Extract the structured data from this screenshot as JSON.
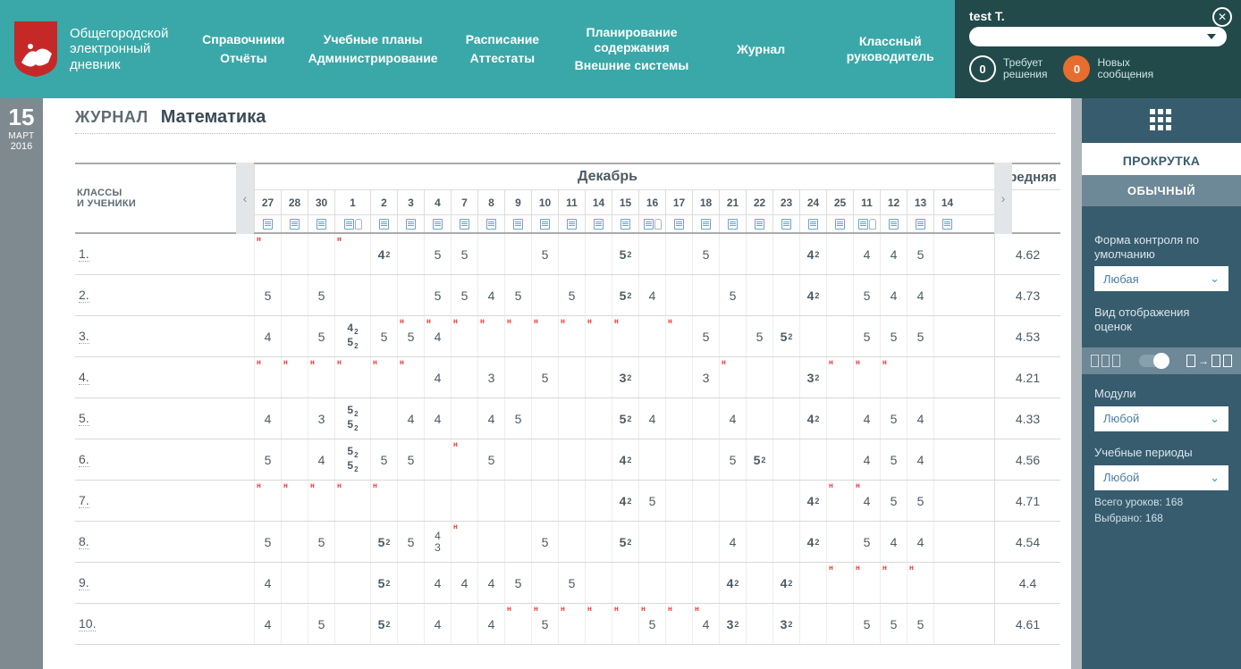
{
  "header": {
    "title_l1": "Общегородской",
    "title_l2": "электронный",
    "title_l3": "дневник",
    "nav": [
      [
        "Справочники",
        "Отчёты"
      ],
      [
        "Учебные планы",
        "Администрирование"
      ],
      [
        "Расписание",
        "Аттестаты"
      ],
      [
        "Планирование содержания",
        "Внешние системы"
      ],
      [
        "Журнал",
        ""
      ],
      [
        "Классный руководитель",
        ""
      ]
    ]
  },
  "user": {
    "name": "test T.",
    "counter1": {
      "n": "0",
      "label_l1": "Требует",
      "label_l2": "решения"
    },
    "counter2": {
      "n": "0",
      "label_l1": "Новых",
      "label_l2": "сообщения"
    }
  },
  "date": {
    "day": "15",
    "month": "МАРТ",
    "year": "2016"
  },
  "title": {
    "section": "ЖУРНАЛ",
    "subject": "Математика"
  },
  "grid": {
    "students_head_l1": "КЛАССЫ",
    "students_head_l2": "И УЧЕНИКИ",
    "month_main": "Декабрь",
    "avg_head": "Средняя",
    "days": [
      "27",
      "28",
      "30",
      "1",
      "2",
      "3",
      "4",
      "7",
      "8",
      "9",
      "10",
      "11",
      "14",
      "15",
      "16",
      "17",
      "18",
      "21",
      "22",
      "23",
      "24",
      "25",
      "11",
      "12",
      "13",
      "14"
    ],
    "wide_idx": [
      3
    ],
    "icons": [
      "b",
      "b",
      "b",
      "bc",
      "b",
      "b",
      "b",
      "b",
      "b",
      "b",
      "b",
      "b",
      "b",
      "b",
      "bc",
      "b",
      "b",
      "b",
      "b",
      "b",
      "b",
      "b",
      "bc",
      "b",
      "b",
      "b"
    ],
    "students": [
      "1.",
      "2.",
      "3.",
      "4.",
      "5.",
      "6.",
      "7.",
      "8.",
      "9.",
      "10."
    ],
    "grades": [
      [
        {
          "h": 1
        },
        {},
        {},
        {
          "h": 1
        },
        {
          "v": "4",
          "s": "2",
          "b": 1
        },
        {},
        {
          "v": "5"
        },
        {
          "v": "5"
        },
        {},
        {},
        {
          "v": "5"
        },
        {},
        {},
        {
          "v": "5",
          "s": "2",
          "b": 1
        },
        {},
        {},
        {
          "v": "5"
        },
        {},
        {},
        {},
        {
          "v": "4",
          "s": "2",
          "b": 1
        },
        {},
        {
          "v": "4"
        },
        {
          "v": "4"
        },
        {
          "v": "5"
        },
        {}
      ],
      [
        {
          "v": "5"
        },
        {},
        {
          "v": "5"
        },
        {},
        {},
        {},
        {
          "v": "5"
        },
        {
          "v": "5"
        },
        {
          "v": "4"
        },
        {
          "v": "5"
        },
        {},
        {
          "v": "5"
        },
        {},
        {
          "v": "5",
          "s": "2",
          "b": 1
        },
        {
          "v": "4"
        },
        {},
        {},
        {
          "v": "5"
        },
        {},
        {},
        {
          "v": "4",
          "s": "2",
          "b": 1
        },
        {},
        {
          "v": "5"
        },
        {
          "v": "4"
        },
        {
          "v": "4"
        },
        {}
      ],
      [
        {
          "v": "4"
        },
        {},
        {
          "v": "5"
        },
        {
          "st": [
            "4_2",
            "5_2"
          ]
        },
        {
          "v": "5"
        },
        {
          "v": "5",
          "h": 1
        },
        {
          "h": 1,
          "v": "4"
        },
        {
          "h": 1
        },
        {
          "h": 1
        },
        {
          "h": 1
        },
        {
          "h": 1
        },
        {
          "h": 1
        },
        {
          "h": 1
        },
        {
          "h": 1
        },
        {},
        {
          "h": 1
        },
        {
          "v": "5"
        },
        {},
        {
          "v": "5"
        },
        {
          "v": "5",
          "s": "2",
          "b": 1
        },
        {},
        {},
        {
          "v": "5"
        },
        {
          "v": "5"
        },
        {
          "v": "5"
        },
        {}
      ],
      [
        {
          "h": 1
        },
        {
          "h": 1
        },
        {
          "h": 1
        },
        {
          "h": 1
        },
        {
          "h": 1
        },
        {
          "h": 1
        },
        {
          "v": "4"
        },
        {},
        {
          "v": "3"
        },
        {},
        {
          "v": "5"
        },
        {},
        {},
        {
          "v": "3",
          "s": "2",
          "b": 1
        },
        {},
        {},
        {
          "v": "3"
        },
        {
          "h": 1
        },
        {},
        {},
        {
          "v": "3",
          "s": "2",
          "b": 1
        },
        {
          "h": 1
        },
        {
          "h": 1
        },
        {
          "h": 1
        },
        {},
        {}
      ],
      [
        {
          "v": "4"
        },
        {},
        {
          "v": "3"
        },
        {
          "st": [
            "5_2",
            "5_2"
          ]
        },
        {},
        {
          "v": "4"
        },
        {
          "v": "4"
        },
        {},
        {
          "v": "4"
        },
        {
          "v": "5"
        },
        {},
        {},
        {},
        {
          "v": "5",
          "s": "2",
          "b": 1
        },
        {
          "v": "4"
        },
        {},
        {},
        {
          "v": "4"
        },
        {},
        {},
        {
          "v": "4",
          "s": "2",
          "b": 1
        },
        {},
        {
          "v": "4"
        },
        {
          "v": "5"
        },
        {
          "v": "4"
        },
        {}
      ],
      [
        {
          "v": "5"
        },
        {},
        {
          "v": "4"
        },
        {
          "st": [
            "5_2",
            "5_2"
          ]
        },
        {
          "v": "5"
        },
        {
          "v": "5"
        },
        {},
        {
          "h": 1
        },
        {
          "v": "5"
        },
        {},
        {},
        {},
        {},
        {
          "v": "4",
          "s": "2",
          "b": 1
        },
        {},
        {},
        {},
        {
          "v": "5"
        },
        {
          "v": "5",
          "s": "2",
          "b": 1
        },
        {},
        {},
        {},
        {
          "v": "4"
        },
        {
          "v": "5"
        },
        {
          "v": "4"
        },
        {}
      ],
      [
        {
          "h": 1
        },
        {
          "h": 1
        },
        {
          "h": 1
        },
        {
          "h": 1
        },
        {
          "h": 1
        },
        {},
        {},
        {},
        {},
        {},
        {},
        {},
        {},
        {
          "v": "4",
          "s": "2",
          "b": 1
        },
        {
          "v": "5"
        },
        {},
        {},
        {},
        {},
        {},
        {
          "v": "4",
          "s": "2",
          "b": 1
        },
        {
          "h": 1
        },
        {
          "v": "4",
          "h": 1
        },
        {
          "v": "5"
        },
        {
          "v": "5"
        },
        {}
      ],
      [
        {
          "v": "5"
        },
        {},
        {
          "v": "5"
        },
        {},
        {
          "v": "5",
          "s": "2",
          "b": 1
        },
        {
          "v": "5"
        },
        {
          "v": "4",
          "sp": "3"
        },
        {
          "h": 1
        },
        {},
        {},
        {
          "v": "5"
        },
        {},
        {},
        {
          "v": "5",
          "s": "2",
          "b": 1
        },
        {},
        {},
        {},
        {
          "v": "4"
        },
        {},
        {},
        {
          "v": "4",
          "s": "2",
          "b": 1
        },
        {},
        {
          "v": "5"
        },
        {
          "v": "4"
        },
        {
          "v": "4"
        },
        {}
      ],
      [
        {
          "v": "4"
        },
        {},
        {},
        {},
        {
          "v": "5",
          "s": "2",
          "b": 1
        },
        {},
        {
          "v": "4"
        },
        {
          "v": "4"
        },
        {
          "v": "4"
        },
        {
          "v": "5"
        },
        {},
        {
          "v": "5"
        },
        {},
        {},
        {},
        {},
        {},
        {
          "v": "4",
          "s": "2",
          "b": 1
        },
        {},
        {
          "v": "4",
          "s": "2",
          "b": 1
        },
        {},
        {
          "h": 1
        },
        {
          "h": 1
        },
        {
          "h": 1
        },
        {
          "h": 1
        },
        {}
      ],
      [
        {
          "v": "4"
        },
        {},
        {
          "v": "5"
        },
        {},
        {
          "v": "5",
          "s": "2",
          "b": 1
        },
        {},
        {
          "v": "4"
        },
        {},
        {
          "v": "4"
        },
        {
          "h": 1
        },
        {
          "h": 1,
          "v": "5"
        },
        {
          "h": 1
        },
        {
          "h": 1
        },
        {
          "h": 1
        },
        {
          "h": 1,
          "v": "5"
        },
        {
          "h": 1
        },
        {
          "h": 1,
          "v": "4"
        },
        {
          "v": "3",
          "s": "2",
          "b": 1
        },
        {},
        {
          "v": "3",
          "s": "2",
          "b": 1
        },
        {},
        {},
        {
          "v": "5"
        },
        {
          "v": "5"
        },
        {
          "v": "5"
        },
        {}
      ]
    ],
    "avgs": [
      "4.62",
      "4.73",
      "4.53",
      "4.21",
      "4.33",
      "4.56",
      "4.71",
      "4.54",
      "4.4",
      "4.61"
    ]
  },
  "side": {
    "scroll_title": "ПРОКРУТКА",
    "mode": "ОБЫЧНЫЙ",
    "control_label": "Форма контроля по умолчанию",
    "control_value": "Любая",
    "view_label": "Вид отображения оценок",
    "modules_label": "Модули",
    "modules_value": "Любой",
    "periods_label": "Учебные периоды",
    "periods_value": "Любой",
    "total_lessons": "Всего уроков: 168",
    "selected": "Выбрано: 168"
  }
}
